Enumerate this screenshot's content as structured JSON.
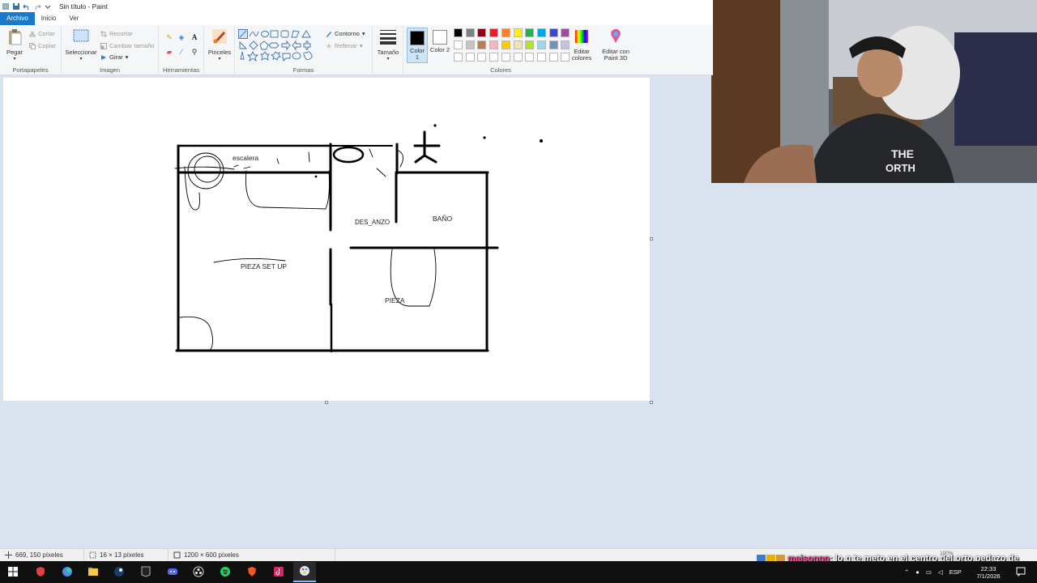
{
  "window": {
    "title": "Sin título - Paint"
  },
  "tabs": [
    {
      "label": "Archivo"
    },
    {
      "label": "Inicio"
    },
    {
      "label": "Ver"
    }
  ],
  "ribbon": {
    "clipboard": {
      "label": "Portapapeles",
      "paste": "Pegar",
      "cut": "Cortar",
      "copy": "Copiar"
    },
    "image": {
      "label": "Imagen",
      "select": "Seleccionar",
      "crop": "Recortar",
      "resize": "Cambiar tamaño",
      "rotate": "Girar"
    },
    "tools": {
      "label": "Herramientas",
      "brushes": "Pinceles"
    },
    "shapes": {
      "label": "Formas",
      "outline": "Contorno",
      "fill": "Rellenar"
    },
    "size": {
      "label": "Tamaño"
    },
    "colors": {
      "label": "Colores",
      "color1": "Color 1",
      "color2": "Color 2",
      "edit": "Editar colores",
      "paint3d": "Editar con Paint 3D",
      "color1_value": "#000000",
      "color2_value": "#ffffff",
      "palette_row1": [
        "#000000",
        "#7f7f7f",
        "#880015",
        "#ed1c24",
        "#ff7f27",
        "#fff200",
        "#22b14c",
        "#00a2e8",
        "#3f48cc",
        "#a349a4"
      ],
      "palette_row2": [
        "#ffffff",
        "#c3c3c3",
        "#b97a57",
        "#ffaec9",
        "#ffc90e",
        "#efe4b0",
        "#b5e61d",
        "#99d9ea",
        "#7092be",
        "#c8bfe7"
      ]
    }
  },
  "drawing": {
    "labels": {
      "stairs": "escalera",
      "landing": "DES_ANZO",
      "bathroom": "BAÑO",
      "setup_room": "PIEZA SET UP",
      "room": "PIEZA"
    }
  },
  "status": {
    "cursor_pos": "669, 150 píxeles",
    "selection_size": "16 × 13 píxeles",
    "canvas_size": "1200 × 600 píxeles",
    "zoom": "100%"
  },
  "chat": {
    "username": "maisonnn",
    "message": ": lo q te meto en el centro del orto pedazo de puto"
  },
  "taskbar": {
    "language": "ESP",
    "time": "22:33",
    "date": "7/1/2026"
  }
}
